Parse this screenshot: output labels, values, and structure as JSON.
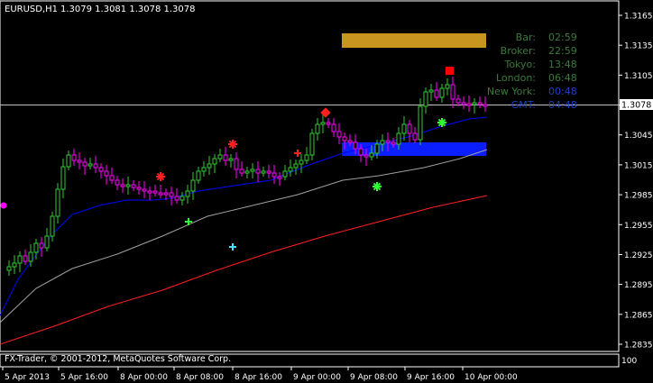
{
  "header": {
    "symbol_timeframe": "EURUSD,H1",
    "ohlc": "1.3079 1.3081 1.3078 1.3078"
  },
  "price_axis": {
    "ticks": [
      "1.3165",
      "1.3135",
      "1.3105",
      "1.3075",
      "1.3045",
      "1.3015",
      "1.2985",
      "1.2955",
      "1.2925",
      "1.2895",
      "1.2865",
      "1.2835"
    ],
    "current_price": "1.3078"
  },
  "time_axis": {
    "labels": [
      "5 Apr 2013",
      "5 Apr 16:00",
      "8 Apr 00:00",
      "8 Apr 08:00",
      "8 Apr 16:00",
      "9 Apr 00:00",
      "9 Apr 08:00",
      "9 Apr 16:00",
      "10 Apr 00:00"
    ]
  },
  "info_panel": {
    "rows": [
      {
        "label": "Bar:",
        "value": "02:59",
        "color": "#3a7a3a",
        "value_color": "#3a7a3a"
      },
      {
        "label": "Broker:",
        "value": "22:59",
        "color": "#3a7a3a",
        "value_color": "#3a7a3a"
      },
      {
        "label": "Tokyo:",
        "value": "13:48",
        "color": "#3a7a3a",
        "value_color": "#3a7a3a"
      },
      {
        "label": "London:",
        "value": "06:48",
        "color": "#3a7a3a",
        "value_color": "#3a7a3a"
      },
      {
        "label": "New York:",
        "value": "00:48",
        "color": "#3a7a3a",
        "value_color": "#1f3fbf"
      },
      {
        "label": "GMT:",
        "value": "04:48",
        "color": "#1f3fbf",
        "value_color": "#1f3fbf"
      }
    ]
  },
  "indicator": {
    "level_value": "100"
  },
  "footer": {
    "copyright": "FX-Trader, © 2001-2012, MetaQuotes Software Corp."
  },
  "colors": {
    "background": "#000000",
    "grid": "#ffffff",
    "bull_candle": "#32cd32",
    "bear_candle": "#ff00ff",
    "ma_fast": "#0000ff",
    "ma_mid": "#a0a0a0",
    "ma_slow": "#ff2020",
    "zone_gold": "#c8961e",
    "zone_blue": "#0a1eff"
  }
}
